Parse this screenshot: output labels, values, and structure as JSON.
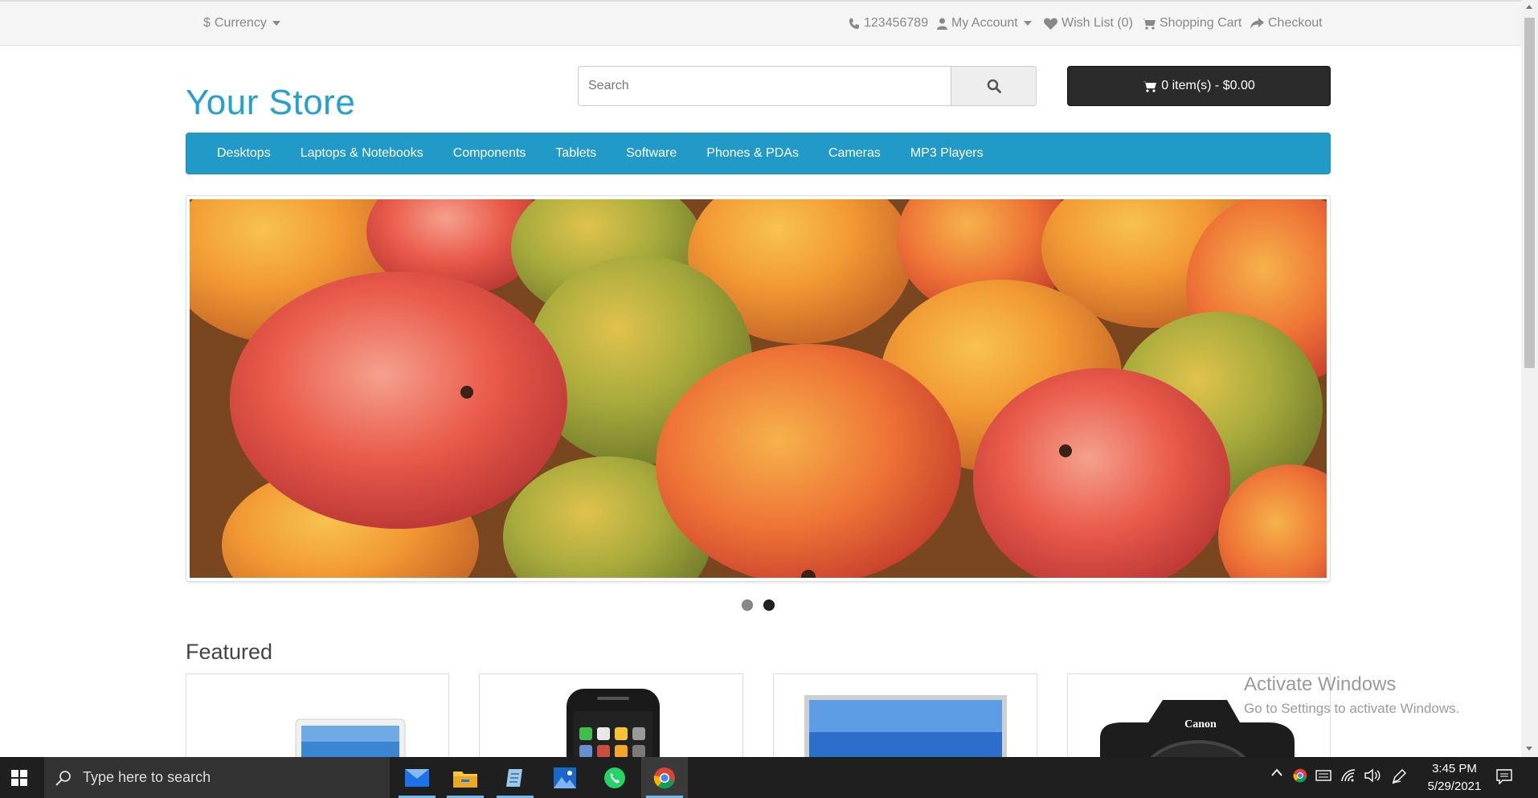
{
  "topbar": {
    "currency": "Currency",
    "phone": "123456789",
    "account": "My Account",
    "wishlist": "Wish List (0)",
    "cart": "Shopping Cart",
    "checkout": "Checkout"
  },
  "header": {
    "store_name": "Your Store",
    "search_placeholder": "Search",
    "cart_label": "0 item(s) - $0.00"
  },
  "menu": {
    "items": [
      "Desktops",
      "Laptops & Notebooks",
      "Components",
      "Tablets",
      "Software",
      "Phones & PDAs",
      "Cameras",
      "MP3 Players"
    ]
  },
  "slider": {
    "slide_count": 2,
    "active_index": 1,
    "colors": {
      "dot_inactive": "#888888",
      "dot_active": "#222222"
    }
  },
  "featured": {
    "title": "Featured",
    "products": [
      {
        "icon": "laptop-icon"
      },
      {
        "icon": "phone-icon"
      },
      {
        "icon": "monitor-icon"
      },
      {
        "icon": "camera-icon",
        "brand_text": "Canon"
      }
    ]
  },
  "watermark": {
    "title": "Activate Windows",
    "subtitle": "Go to Settings to activate Windows."
  },
  "taskbar": {
    "search_placeholder": "Type here to search",
    "time": "3:45 PM",
    "date": "5/29/2021",
    "apps": [
      "mail-icon",
      "file-explorer-icon",
      "notepad-icon",
      "photos-icon",
      "whatsapp-icon",
      "chrome-icon"
    ]
  },
  "colors": {
    "accent": "#229ac8",
    "store_title": "#23a1d1",
    "cart_bg": "#2b2b2b",
    "taskbar_bg": "#1f1f1f"
  }
}
